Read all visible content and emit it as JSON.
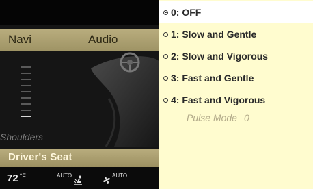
{
  "menu": {
    "navi": "Navi",
    "audio": "Audio"
  },
  "seat": {
    "zone_label": "Shoulders",
    "title": "Driver's Seat",
    "intensity_level": 1,
    "intensity_steps": 9
  },
  "climate": {
    "temperature": "72",
    "unit": "°F",
    "airflow_mode": "AUTO",
    "fan_mode": "AUTO"
  },
  "options": [
    {
      "label": "0: OFF",
      "selected": true
    },
    {
      "label": "1: Slow and Gentle",
      "selected": false
    },
    {
      "label": "2: Slow and Vigorous",
      "selected": false
    },
    {
      "label": "3: Fast and Gentle",
      "selected": false
    },
    {
      "label": "4: Fast and Vigorous",
      "selected": false
    }
  ],
  "pulse": {
    "label": "Pulse Mode",
    "value": "0"
  },
  "colors": {
    "menu_bar": "#b2a675",
    "list_background": "#fffccf",
    "selected_row": "#ffffff"
  },
  "icons": {
    "airflow": "airflow-icon",
    "fan": "fan-icon",
    "radio": "radio-icon"
  }
}
